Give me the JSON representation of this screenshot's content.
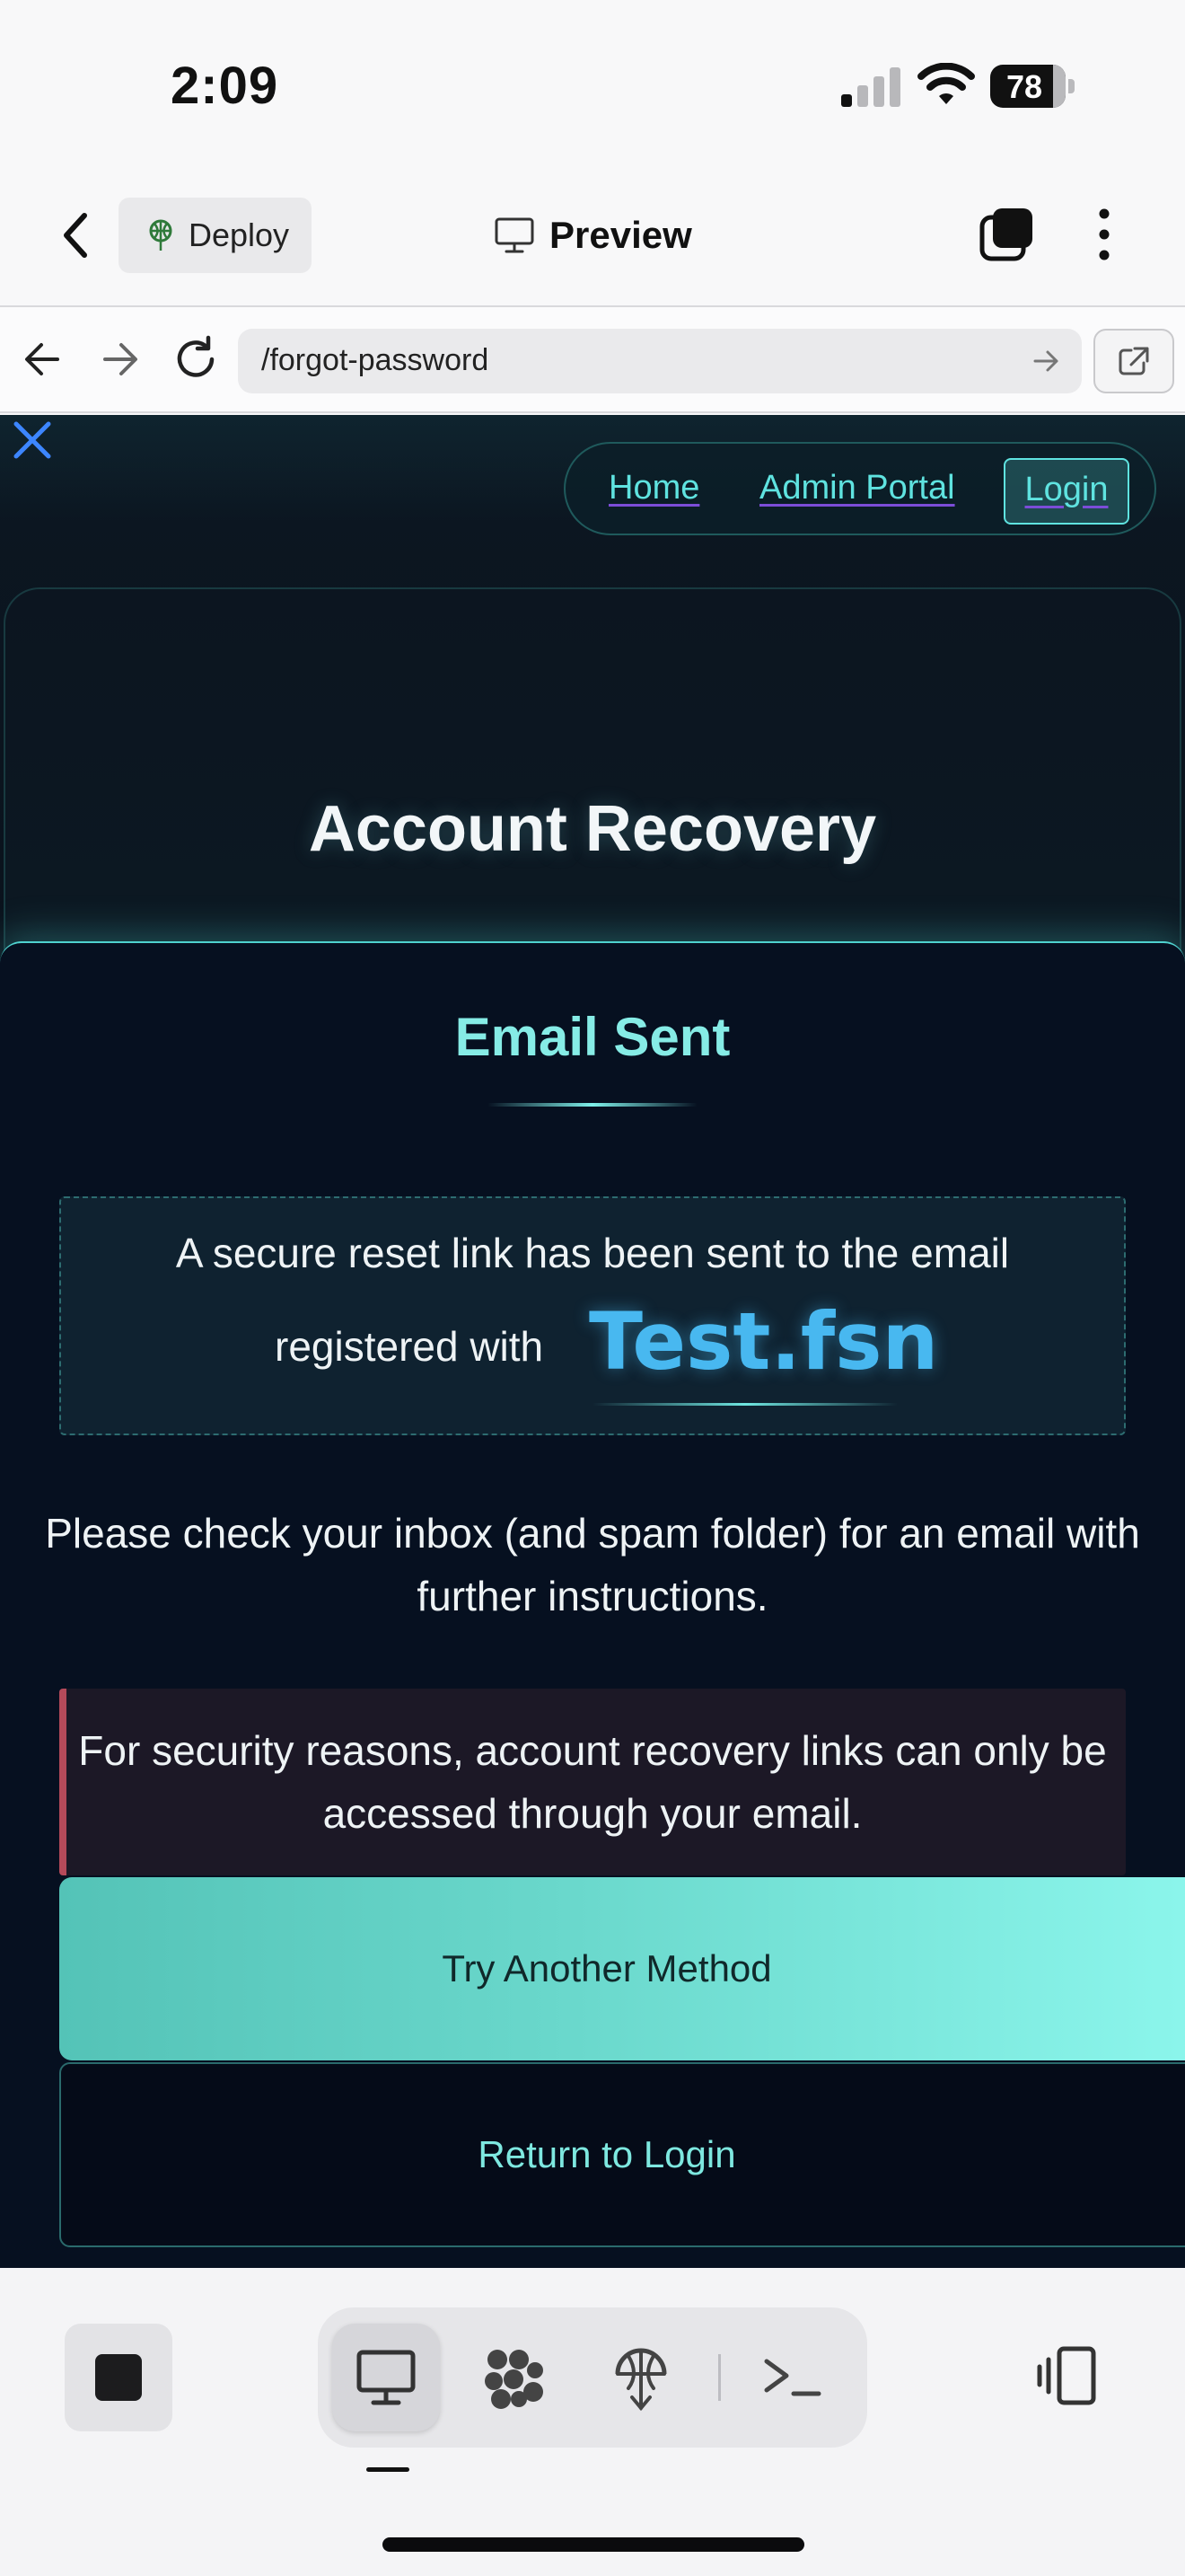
{
  "status_bar": {
    "time": "2:09",
    "battery": "78"
  },
  "app_toolbar": {
    "deploy_label": "Deploy",
    "preview_label": "Preview"
  },
  "url_bar": {
    "url": "/forgot-password"
  },
  "page": {
    "nav": {
      "home": "Home",
      "admin": "Admin Portal",
      "login": "Login"
    },
    "hero_title": "Account Recovery",
    "status_title": "Email Sent",
    "notice": {
      "line1": "A secure reset link has been sent to the email",
      "line2_prefix": "registered with",
      "email": "Test.fsn"
    },
    "instructions": "Please check your inbox (and spam folder) for an email with further instructions.",
    "security_note": "For security reasons, account recovery links can only be accessed through your email.",
    "try_another_label": "Try Another Method",
    "return_label": "Return to Login"
  },
  "bottom_bar": {
    "tabs": [
      "desktop-preview",
      "apps",
      "deploy",
      "terminal"
    ],
    "active_tab": "desktop-preview"
  },
  "colors": {
    "accent": "#5fe3e0",
    "email_blue": "#48b8f0",
    "warning_bar": "#b54a5a",
    "page_bg": "#061020"
  }
}
